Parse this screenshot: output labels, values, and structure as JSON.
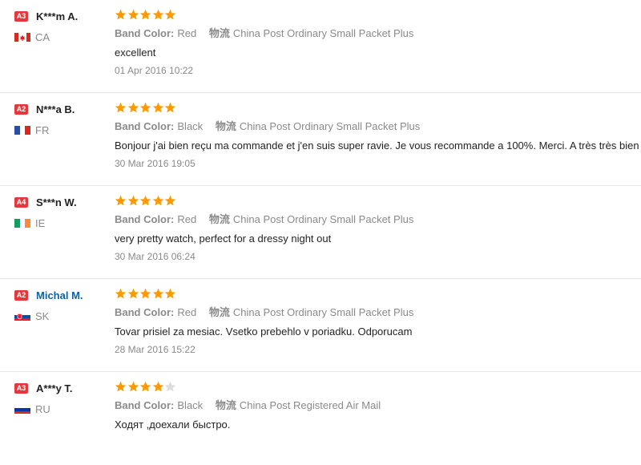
{
  "colors": {
    "star_filled": "#ff9900",
    "star_empty": "#dddddd",
    "badge": "#e4393c",
    "user_link": "#0b63a8"
  },
  "reviews": [
    {
      "level": "A3",
      "user": "K***m A.",
      "user_is_link": false,
      "flag": "flag-ca-icon",
      "country": "CA",
      "rating": 5,
      "attr_label": "Band Color:",
      "attr_value": "Red",
      "ship_label": "物流",
      "ship_value": "China Post Ordinary Small Packet Plus",
      "comment": "excellent",
      "date": "01 Apr 2016 10:22"
    },
    {
      "level": "A2",
      "user": "N***a B.",
      "user_is_link": false,
      "flag": "flag-fr-icon",
      "country": "FR",
      "rating": 5,
      "attr_label": "Band Color:",
      "attr_value": "Black",
      "ship_label": "物流",
      "ship_value": "China Post Ordinary Small Packet Plus",
      "comment": "Bonjour j'ai bien reçu ma commande et j'en suis super ravie. Je vous recommande a 100%. Merci. A très très bien",
      "date": "30 Mar 2016 19:05"
    },
    {
      "level": "A4",
      "user": "S***n W.",
      "user_is_link": false,
      "flag": "flag-ie-icon",
      "country": "IE",
      "rating": 5,
      "attr_label": "Band Color:",
      "attr_value": "Red",
      "ship_label": "物流",
      "ship_value": "China Post Ordinary Small Packet Plus",
      "comment": "very pretty watch, perfect for a dressy night out",
      "date": "30 Mar 2016 06:24"
    },
    {
      "level": "A2",
      "user": "Michal M.",
      "user_is_link": true,
      "flag": "flag-sk-icon",
      "country": "SK",
      "rating": 5,
      "attr_label": "Band Color:",
      "attr_value": "Red",
      "ship_label": "物流",
      "ship_value": "China Post Ordinary Small Packet Plus",
      "comment": "Tovar prisiel za mesiac. Vsetko prebehlo v poriadku. Odporucam",
      "date": "28 Mar 2016 15:22"
    },
    {
      "level": "A3",
      "user": "A***y T.",
      "user_is_link": false,
      "flag": "flag-ru-icon",
      "country": "RU",
      "rating": 4,
      "attr_label": "Band Color:",
      "attr_value": "Black",
      "ship_label": "物流",
      "ship_value": "China Post Registered Air Mail",
      "comment": "Ходят ,доехали быстро.",
      "date": ""
    }
  ]
}
